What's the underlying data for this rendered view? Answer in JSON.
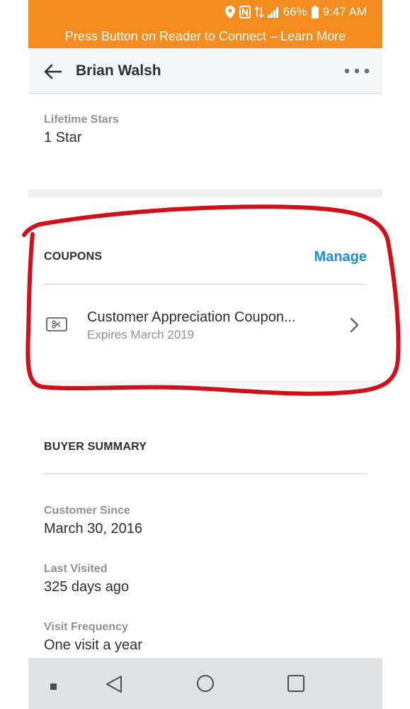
{
  "status_bar": {
    "battery": "66%",
    "time": "9:47 AM",
    "icons": [
      "location-icon",
      "nfc-icon",
      "data-icon",
      "signal-icon",
      "battery-icon"
    ]
  },
  "banner": {
    "text": "Press Button on Reader to Connect – Learn More"
  },
  "header": {
    "title": "Brian Walsh"
  },
  "lifetime": {
    "label": "Lifetime Stars",
    "value": "1 Star"
  },
  "coupons": {
    "section_title": "COUPONS",
    "manage_label": "Manage",
    "items": [
      {
        "title": "Customer Appreciation Coupon...",
        "subtitle": "Expires March 2019"
      }
    ]
  },
  "buyer_summary": {
    "section_title": "BUYER SUMMARY",
    "fields": [
      {
        "label": "Customer Since",
        "value": "March 30, 2016"
      },
      {
        "label": "Last Visited",
        "value": "325 days ago"
      },
      {
        "label": "Visit Frequency",
        "value": "One visit a year"
      }
    ]
  },
  "colors": {
    "accent_orange": "#f58c1f",
    "link_blue": "#1a8fd4",
    "highlight_red": "#d0101a"
  }
}
